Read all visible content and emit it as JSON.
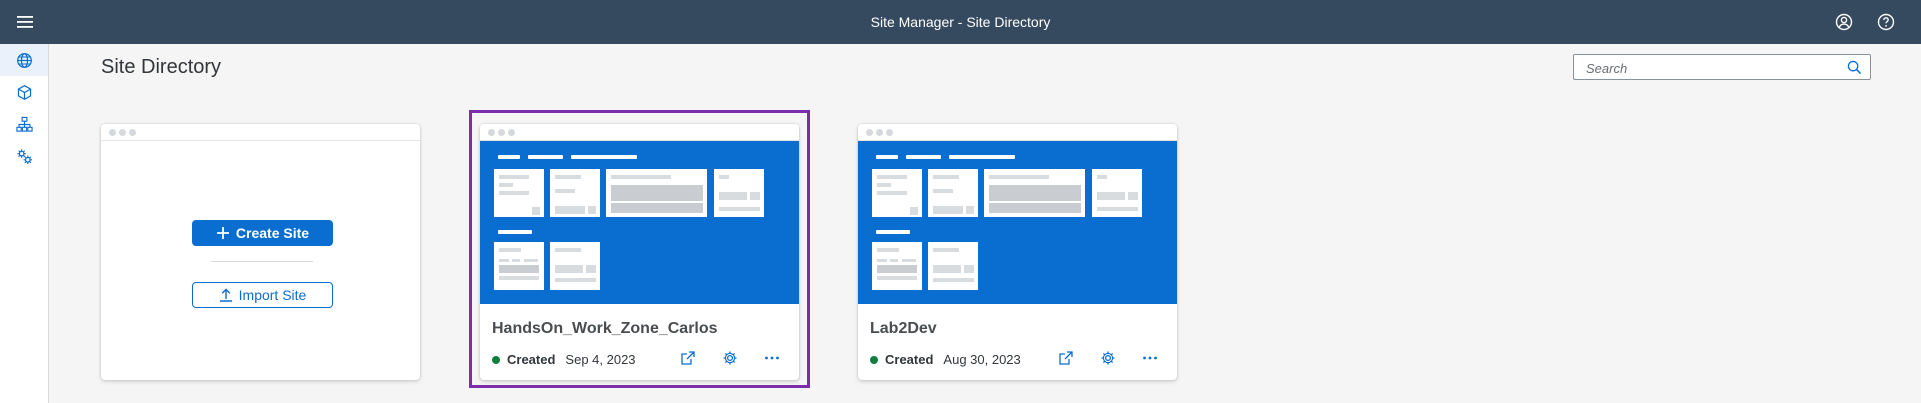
{
  "shellbar": {
    "title": "Site Manager - Site Directory",
    "menu_icon": "hamburger-icon",
    "user_icon": "user-icon",
    "help_icon": "help-icon"
  },
  "sidebar": {
    "items": [
      {
        "name": "site-directory",
        "icon": "globe-icon",
        "active": true
      },
      {
        "name": "content-manager",
        "icon": "cube-icon",
        "active": false
      },
      {
        "name": "channel-manager",
        "icon": "org-chart-icon",
        "active": false
      },
      {
        "name": "settings",
        "icon": "gears-icon",
        "active": false
      }
    ]
  },
  "page": {
    "title": "Site Directory"
  },
  "search": {
    "placeholder": "Search",
    "value": ""
  },
  "new_site_card": {
    "create_label": "Create Site",
    "import_label": "Import Site"
  },
  "sites": [
    {
      "name": "HandsOn_Work_Zone_Carlos",
      "status": "Created",
      "date": "Sep 4, 2023",
      "selected": true
    },
    {
      "name": "Lab2Dev",
      "status": "Created",
      "date": "Aug 30, 2023",
      "selected": false
    }
  ],
  "colors": {
    "shellbar": "#354a5f",
    "accent": "#0a6ed1",
    "status_created": "#107e3e",
    "selection": "#7b2dab"
  }
}
